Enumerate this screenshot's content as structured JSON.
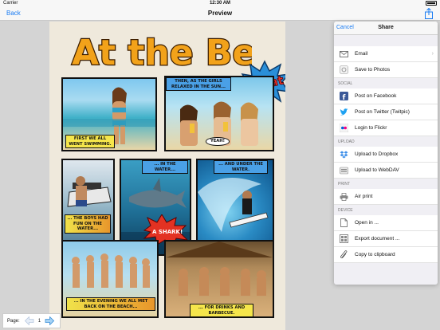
{
  "status_bar": {
    "carrier": "Carrier",
    "time": "12:30 AM"
  },
  "nav": {
    "back_label": "Back",
    "title": "Preview"
  },
  "comic": {
    "title": "At the Beach",
    "splat": "Splat",
    "captions": {
      "p1": "FIRST WE ALL WENT SWIMMING.",
      "p2_top": "THEN, AS THE GIRLS RELAXED IN THE SUN...",
      "p2_bubble": "YEAH!",
      "p3": "... THE BOYS HAD FUN ON THE WATER...",
      "p4_top": "... IN THE WATER...",
      "p4_burst": "A SHARK!",
      "p5_top": "... AND UNDER THE WATER.",
      "p6": "... IN THE EVENING WE ALL MET BACK ON THE BEACH...",
      "p7": "... FOR DRINKS AND BARBECUE."
    }
  },
  "share": {
    "cancel_label": "Cancel",
    "title": "Share",
    "top_items": [
      {
        "label": "Email",
        "icon": "envelope-icon"
      },
      {
        "label": "Save to Photos",
        "icon": "photos-icon"
      }
    ],
    "sections": [
      {
        "header": "SOCIAL",
        "items": [
          {
            "label": "Post on Facebook",
            "icon": "facebook-icon"
          },
          {
            "label": "Post on Twitter (Twitpic)",
            "icon": "twitter-icon"
          },
          {
            "label": "Login to Flickr",
            "icon": "flickr-icon"
          }
        ]
      },
      {
        "header": "UPLOAD",
        "items": [
          {
            "label": "Upload to Dropbox",
            "icon": "dropbox-icon"
          },
          {
            "label": "Upload to WebDAV",
            "icon": "webdav-icon"
          }
        ]
      },
      {
        "header": "PRINT",
        "items": [
          {
            "label": "Air print",
            "icon": "printer-icon"
          }
        ]
      },
      {
        "header": "DEVICE",
        "items": [
          {
            "label": "Open in ...",
            "icon": "open-in-icon"
          },
          {
            "label": "Export document ...",
            "icon": "export-icon"
          },
          {
            "label": "Copy to clipboard",
            "icon": "clipboard-icon"
          }
        ]
      }
    ]
  },
  "pager": {
    "label": "Page:",
    "current": "1"
  },
  "colors": {
    "accent": "#1a7cf3",
    "facebook": "#3b5998",
    "twitter": "#1da1f2",
    "dropbox": "#3d8ee8"
  }
}
